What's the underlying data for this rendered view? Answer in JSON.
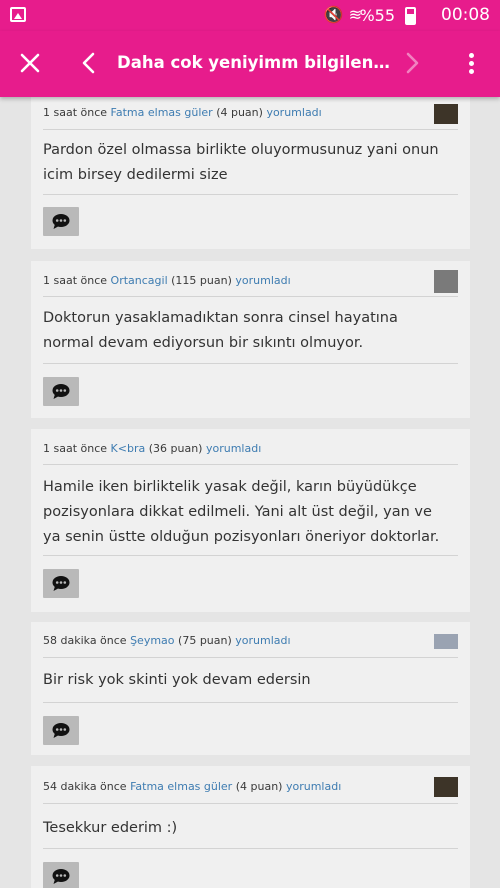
{
  "status_bar": {
    "icons": "🔇 ≋",
    "battery": "%55",
    "time": "00:08"
  },
  "app_bar": {
    "title": "Daha cok yeniyimm bilgilendirirm..."
  },
  "comments": [
    {
      "time": "1 saat önce",
      "author": "Fatma elmas güler",
      "points": "(4 puan)",
      "action": "yorumladı",
      "text": "Pardon özel olmassa birlikte oluyormusunuz yani onun icim birsey dedilermi size"
    },
    {
      "time": "1 saat önce",
      "author": "Ortancagil",
      "points": "(115 puan)",
      "action": "yorumladı",
      "text": "Doktorun yasaklamadıktan sonra cinsel hayatına normal devam ediyorsun bir sıkıntı olmuyor."
    },
    {
      "time": "1 saat önce",
      "author": "K<bra",
      "points": "(36 puan)",
      "action": "yorumladı",
      "text": "Hamile iken birliktelik yasak değil, karın büyüdükçe pozisyonlara dikkat edilmeli. Yani alt üst değil, yan ve ya senin üstte olduğun pozisyonları öneriyor doktorlar."
    },
    {
      "time": "58 dakika önce",
      "author": "Şeymao",
      "points": "(75 puan)",
      "action": "yorumladı",
      "text": "Bir risk yok skinti yok devam edersin"
    },
    {
      "time": "54 dakika önce",
      "author": "Fatma elmas güler",
      "points": "(4 puan)",
      "action": "yorumladı",
      "text": "Tesekkur ederim :)"
    }
  ]
}
